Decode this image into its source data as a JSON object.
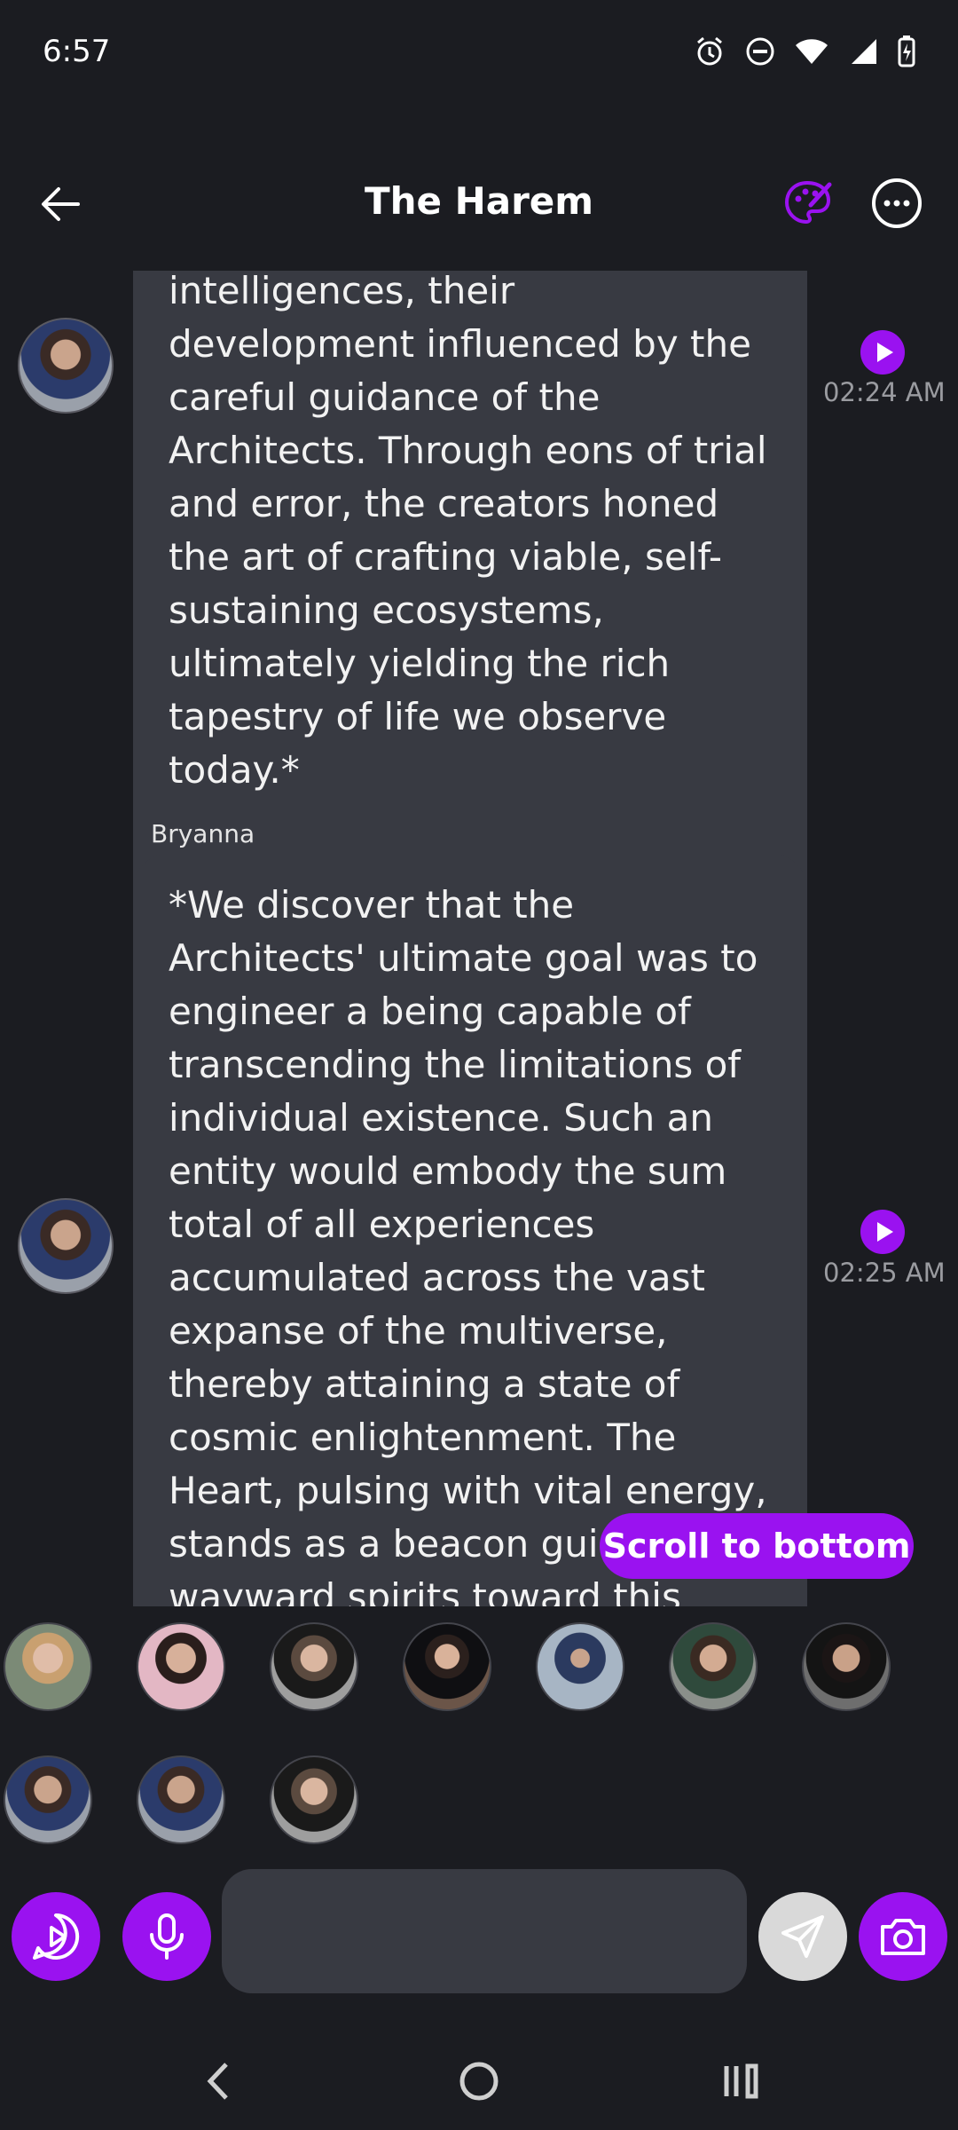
{
  "status_bar": {
    "time": "6:57"
  },
  "header": {
    "title": "The Harem"
  },
  "messages": [
    {
      "sender": "",
      "text": "intelligences, their development influenced by the careful guidance of the Architects. Through eons of trial and error, the creators honed the art of crafting viable, self-sustaining ecosystems, ultimately yielding the rich tapestry of life we observe today.*",
      "time": "02:24 AM"
    },
    {
      "sender": "Bryanna",
      "text": "*We discover that the Architects' ultimate goal was to engineer a being capable of transcending the limitations of individual existence. Such an entity would embody the sum total of all experiences accumulated across the vast expanse of the multiverse, thereby attaining a state of cosmic enlightenment. The Heart, pulsing with vital energy, stands as a beacon guiding the wayward spirits toward this sublime realization.*",
      "time": "02:25 AM"
    }
  ],
  "scroll_to_bottom_label": "Scroll to bottom",
  "composer": {
    "placeholder": ""
  },
  "colors": {
    "accent": "#9a12f0",
    "background": "#1b1c21",
    "bubble": "#383a42"
  }
}
